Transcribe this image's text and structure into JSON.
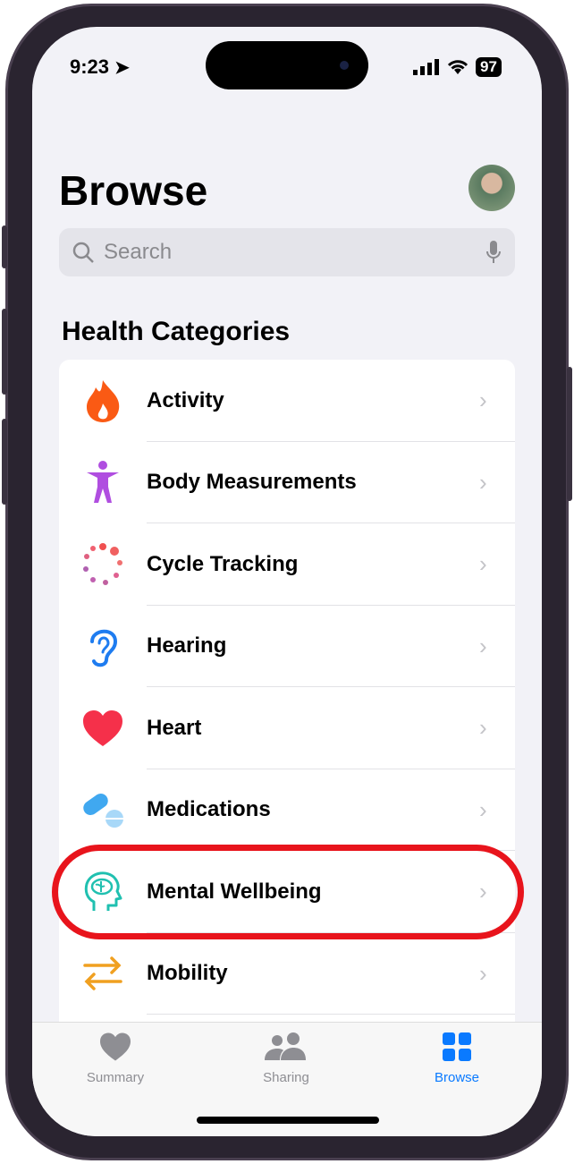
{
  "status_bar": {
    "time": "9:23",
    "battery": "97"
  },
  "header": {
    "title": "Browse"
  },
  "search": {
    "placeholder": "Search"
  },
  "section_title": "Health Categories",
  "categories": [
    {
      "label": "Activity",
      "icon": "flame-icon",
      "color": "#fa5a14"
    },
    {
      "label": "Body Measurements",
      "icon": "person-figure-icon",
      "color": "#b04ee0"
    },
    {
      "label": "Cycle Tracking",
      "icon": "cycle-dots-icon",
      "color": "#f06070"
    },
    {
      "label": "Hearing",
      "icon": "ear-icon",
      "color": "#1e7cf0"
    },
    {
      "label": "Heart",
      "icon": "heart-icon",
      "color": "#f5304a"
    },
    {
      "label": "Medications",
      "icon": "pills-icon",
      "color": "#40a8f0"
    },
    {
      "label": "Mental Wellbeing",
      "icon": "head-brain-icon",
      "color": "#20c0b0"
    },
    {
      "label": "Mobility",
      "icon": "arrows-icon",
      "color": "#f0a020"
    }
  ],
  "highlight": {
    "target": "Mental Wellbeing",
    "color": "#e8141c"
  },
  "tabs": [
    {
      "label": "Summary",
      "icon": "heart-icon",
      "active": false
    },
    {
      "label": "Sharing",
      "icon": "people-icon",
      "active": false
    },
    {
      "label": "Browse",
      "icon": "grid-icon",
      "active": true
    }
  ],
  "accent": "#0a7aff"
}
